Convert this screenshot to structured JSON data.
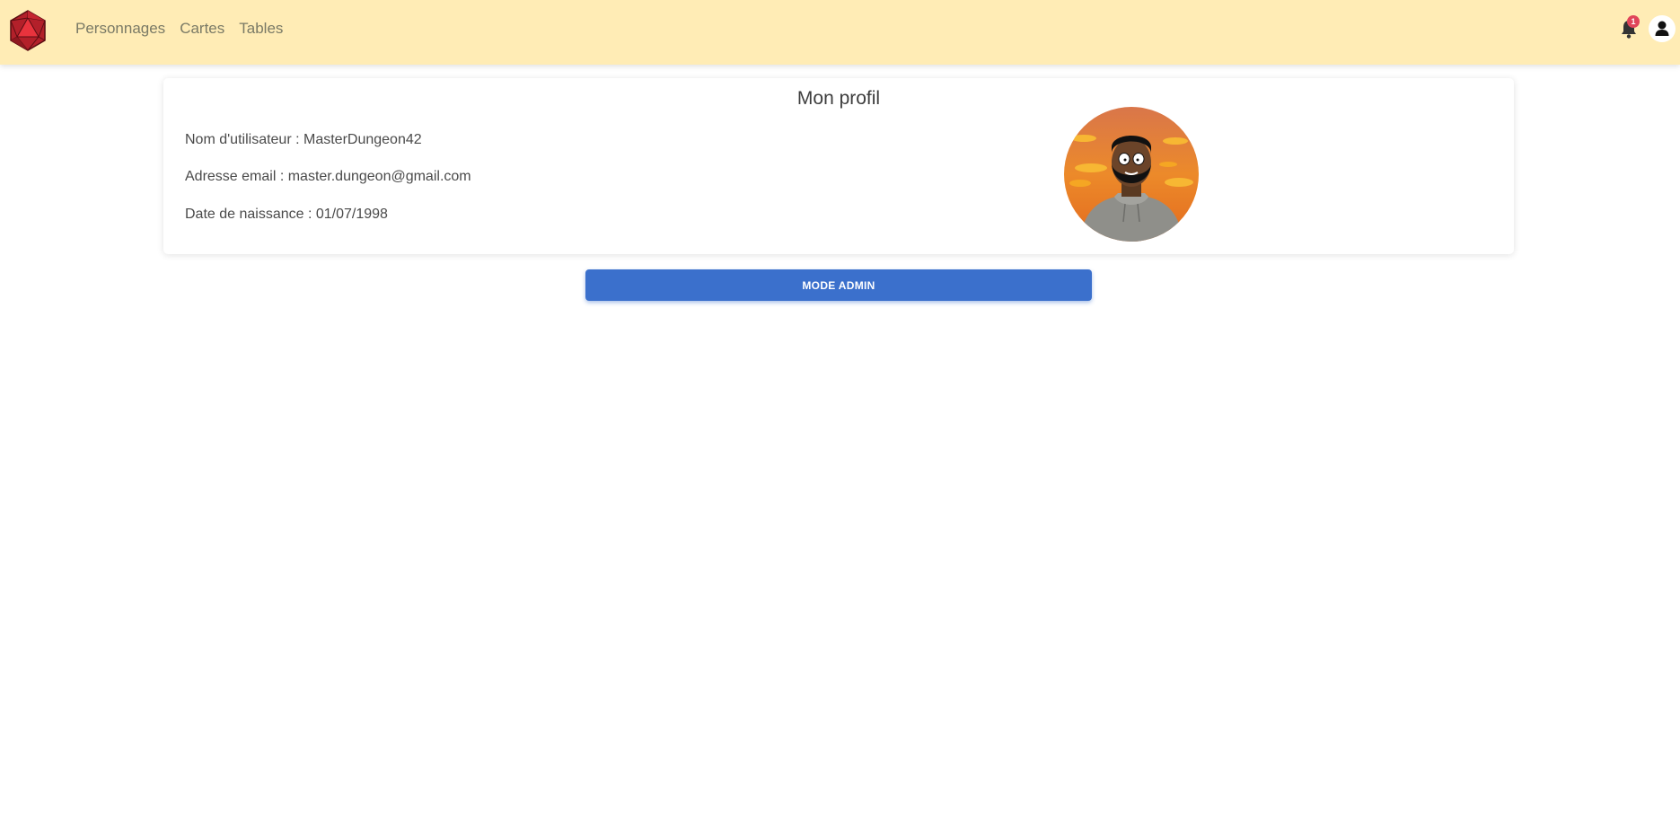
{
  "nav": {
    "logo_icon": "d20-dice-icon",
    "links": [
      {
        "label": "Personnages"
      },
      {
        "label": "Cartes"
      },
      {
        "label": "Tables"
      }
    ],
    "notifications": {
      "icon": "bell-icon",
      "count": "1"
    },
    "user_icon": "user-icon"
  },
  "profile": {
    "title": "Mon profil",
    "username_line": "Nom d'utilisateur : MasterDungeon42",
    "email_line": "Adresse email : master.dungeon@gmail.com",
    "birthdate_line": "Date de naissance : 01/07/1998",
    "avatar_icon": "avatar-image"
  },
  "actions": {
    "admin_label": "MODE ADMIN"
  },
  "colors": {
    "navbar": "#ffecb5",
    "primary": "#3b70cc",
    "badge": "#e0455a"
  }
}
